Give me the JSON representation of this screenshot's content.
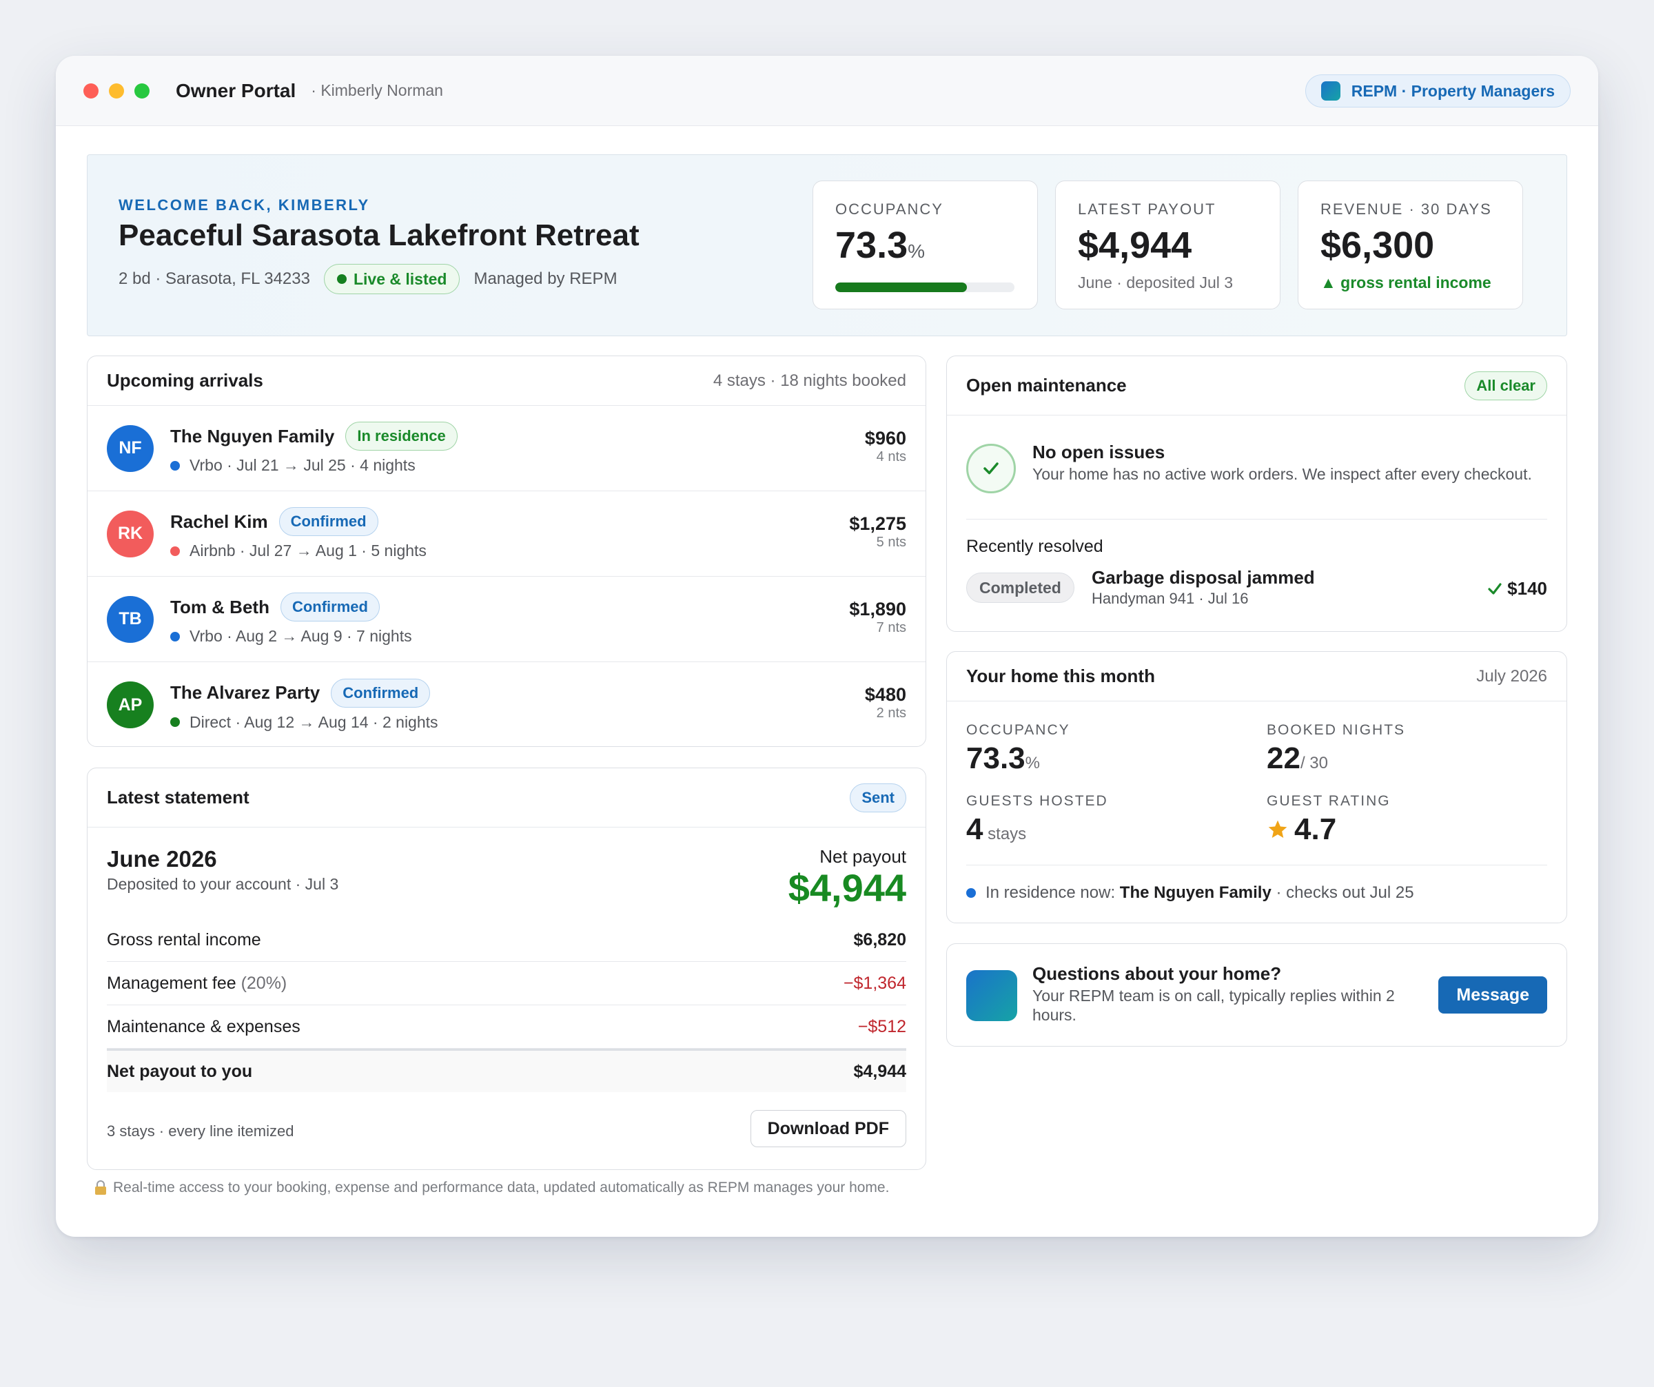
{
  "titlebar": {
    "app_title": "Owner Portal",
    "owner_name": "· Kimberly Norman",
    "brand_label": "REPM · Property Managers"
  },
  "hero": {
    "welcome": "WELCOME BACK, KIMBERLY",
    "title": "Peaceful Sarasota Lakefront Retreat",
    "location": "2 bd · Sarasota, FL 34233",
    "status": "Live & listed",
    "managed": "Managed by REPM",
    "stats": [
      {
        "label": "OCCUPANCY",
        "value": "73.3",
        "unit": "%",
        "progress": 0.733
      },
      {
        "label": "LATEST PAYOUT",
        "value": "$4,944",
        "sub": "June · deposited Jul 3"
      },
      {
        "label": "REVENUE · 30 DAYS",
        "value": "$6,300",
        "sub": "▲ gross rental income"
      }
    ]
  },
  "arrivals": {
    "title": "Upcoming arrivals",
    "meta": "4 stays · 18 nights booked",
    "items": [
      {
        "initials": "NF",
        "avatar_color": "#1a6fd6",
        "name": "The Nguyen Family",
        "badge": "In residence",
        "badge_type": "green",
        "channel_color": "#1a6fd6",
        "detail": "Vrbo · Jul 21 → Jul 25 · 4 nights",
        "amount": "$960",
        "nights": "4 nts"
      },
      {
        "initials": "RK",
        "avatar_color": "#f25c5c",
        "name": "Rachel Kim",
        "badge": "Confirmed",
        "badge_type": "blue",
        "channel_color": "#f25c5c",
        "detail": "Airbnb · Jul 27 → Aug 1 · 5 nights",
        "amount": "$1,275",
        "nights": "5 nts"
      },
      {
        "initials": "TB",
        "avatar_color": "#1a6fd6",
        "name": "Tom & Beth",
        "badge": "Confirmed",
        "badge_type": "blue",
        "channel_color": "#1a6fd6",
        "detail": "Vrbo · Aug 2 → Aug 9 · 7 nights",
        "amount": "$1,890",
        "nights": "7 nts"
      },
      {
        "initials": "AP",
        "avatar_color": "#17801f",
        "name": "The Alvarez Party",
        "badge": "Confirmed",
        "badge_type": "blue",
        "channel_color": "#17801f",
        "detail": "Direct · Aug 12 → Aug 14 · 2 nights",
        "amount": "$480",
        "nights": "2 nts"
      }
    ]
  },
  "statement": {
    "title": "Latest statement",
    "badge": "Sent",
    "period": "June 2026",
    "deposited": "Deposited to your account · Jul 3",
    "net_label": "Net payout",
    "net_value": "$4,944",
    "lines": [
      {
        "label": "Gross rental income",
        "note": "",
        "value": "$6,820",
        "type": "normal"
      },
      {
        "label": "Management fee",
        "note": " (20%)",
        "value": "−$1,364",
        "type": "red"
      },
      {
        "label": "Maintenance & expenses",
        "note": "",
        "value": "−$512",
        "type": "red"
      }
    ],
    "total_label": "Net payout to you",
    "total_value": "$4,944",
    "footer": "3 stays · every line itemized",
    "download": "Download PDF"
  },
  "maintenance": {
    "title": "Open maintenance",
    "badge": "All clear",
    "no_issues_title": "No open issues",
    "no_issues_text": "Your home has no active work orders. We inspect after every checkout.",
    "resolved_label": "Recently resolved",
    "resolved": {
      "status": "Completed",
      "title": "Garbage disposal jammed",
      "meta": "Handyman 941 · Jul 16",
      "amount": "$140"
    }
  },
  "month": {
    "title": "Your home this month",
    "period": "July 2026",
    "stats": {
      "occupancy": {
        "label": "OCCUPANCY",
        "value": "73.3",
        "unit": "%"
      },
      "booked": {
        "label": "BOOKED NIGHTS",
        "value": "22",
        "unit": "/ 30"
      },
      "guests": {
        "label": "GUESTS HOSTED",
        "value": "4",
        "unit": " stays"
      },
      "rating": {
        "label": "GUEST RATING",
        "value": "4.7"
      }
    },
    "residence_prefix": "In residence now: ",
    "residence_name": "The Nguyen Family",
    "residence_suffix": " · checks out Jul 25"
  },
  "contact": {
    "title": "Questions about your home?",
    "text": "Your REPM team is on call, typically replies within 2 hours.",
    "button": "Message"
  },
  "footer": {
    "note": "Real-time access to your booking, expense and performance data, updated automatically as REPM manages your home."
  },
  "colors": {
    "accent_blue": "#1769b5",
    "success_green": "#1a8a2a",
    "negative_red": "#c0262d"
  }
}
